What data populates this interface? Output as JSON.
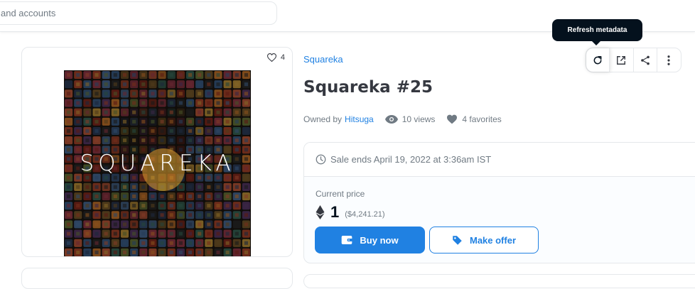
{
  "search": {
    "placeholder_visible": "and accounts"
  },
  "asset": {
    "favorites_count": "4",
    "art_text": "SQUAREKA",
    "collection": "Squareka",
    "title": "Squareka #25",
    "owned_by_label": "Owned by",
    "owner": "Hitsuga",
    "views": "10 views",
    "favorites": "4 favorites"
  },
  "tooltip": {
    "text": "Refresh metadata"
  },
  "actions": {
    "icons": [
      "refresh-icon",
      "external-link-icon",
      "share-icon",
      "more-icon"
    ]
  },
  "sale": {
    "ends": "Sale ends April 19, 2022 at 3:36am IST",
    "current_price_label": "Current price",
    "price": "1",
    "usd": "($4,241.21)",
    "buy_label": "Buy now",
    "offer_label": "Make offer"
  },
  "colors": {
    "accent": "#2081e2",
    "dark": "#04111d",
    "muted": "#707a83",
    "border": "#e5e8eb"
  }
}
